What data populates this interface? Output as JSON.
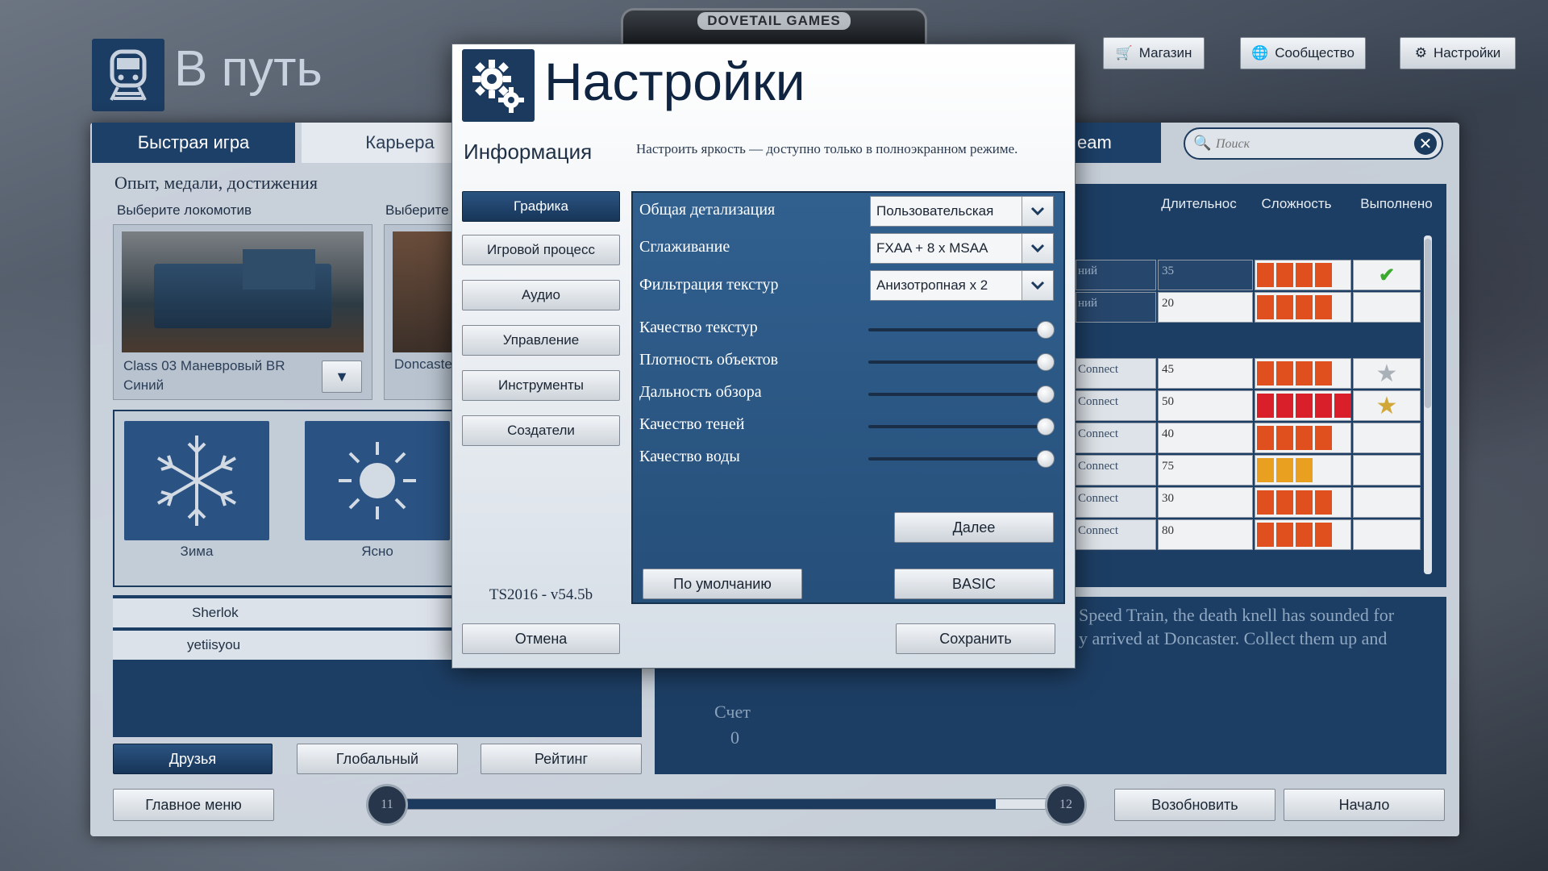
{
  "bg": {
    "publisher": "DOVETAIL GAMES",
    "title": "В путь",
    "tabs": [
      "Быстрая игра",
      "Карьера",
      "eam"
    ],
    "top_buttons": [
      "Магазин",
      "Сообщество",
      "Настройки"
    ],
    "search_placeholder": "Поиск",
    "section": "Опыт, медали, достижения",
    "choose_loco": "Выберите локомотив",
    "choose_route": "Выберите",
    "loco_name": "Class 03 Маневровый BR Синий",
    "route_name": "Doncaste",
    "weather": [
      {
        "label": "Зима"
      },
      {
        "label": "Ясно"
      }
    ],
    "players": [
      "Sherlok",
      "yetiisyou"
    ],
    "board_tabs": [
      "Друзья",
      "Глобальный",
      "Рейтинг"
    ],
    "main_menu": "Главное меню",
    "page_from": "11",
    "page_to": "12",
    "page_progress": 0.92,
    "resume": "Возобновить",
    "start": "Начало",
    "table_headers": [
      "Длительнос",
      "Сложность",
      "Выполнено"
    ],
    "table_rows": [
      {
        "name": "ний",
        "duration": "35",
        "difficulty": 4,
        "done": "check",
        "color": "#e0501e"
      },
      {
        "name": "ний",
        "duration": "20",
        "difficulty": 4,
        "done": "",
        "color": "#e0501e"
      },
      {
        "name": "Connect",
        "duration": "45",
        "difficulty": 4,
        "done": "star-silver",
        "color": "#e0501e"
      },
      {
        "name": "Connect",
        "duration": "50",
        "difficulty": 5,
        "done": "star-gold",
        "color": "#d9202a"
      },
      {
        "name": "Connect",
        "duration": "40",
        "difficulty": 4,
        "done": "",
        "color": "#e0501e"
      },
      {
        "name": "Connect",
        "duration": "75",
        "difficulty": 3,
        "done": "",
        "color": "#e9a020"
      },
      {
        "name": "Connect",
        "duration": "30",
        "difficulty": 4,
        "done": "",
        "color": "#e0501e"
      },
      {
        "name": "Connect",
        "duration": "80",
        "difficulty": 4,
        "done": "",
        "color": "#e0501e"
      }
    ],
    "desc_line1": "Speed Train, the death knell has sounded for",
    "desc_line2": "y arrived at Doncaster. Collect them up and",
    "score_label": "Счет",
    "score_value": "0"
  },
  "modal": {
    "title": "Настройки",
    "info_title": "Информация",
    "info_text": "Настроить яркость — доступно только в полноэкранном режиме.",
    "tabs": [
      "Графика",
      "Игровой процесс",
      "Аудио",
      "Управление",
      "Инструменты",
      "Создатели"
    ],
    "version": "TS2016 - v54.5b",
    "cancel": "Отмена",
    "dropdowns": [
      {
        "label": "Общая детализация",
        "value": "Пользовательская"
      },
      {
        "label": "Сглаживание",
        "value": "FXAA + 8 x MSAA"
      },
      {
        "label": "Фильтрация текстур",
        "value": "Анизотропная x 2"
      }
    ],
    "sliders": [
      {
        "label": "Качество текстур",
        "level": 1.0
      },
      {
        "label": "Плотность объектов",
        "level": 1.0
      },
      {
        "label": "Дальность обзора",
        "level": 1.0
      },
      {
        "label": "Качество теней",
        "level": 1.0
      },
      {
        "label": "Качество воды",
        "level": 1.0
      }
    ],
    "next": "Далее",
    "defaults": "По умолчанию",
    "basic": "BASIC",
    "save": "Сохранить"
  },
  "colors": {
    "accent": "#1a3a5e",
    "panel": "#2d5b8a"
  }
}
